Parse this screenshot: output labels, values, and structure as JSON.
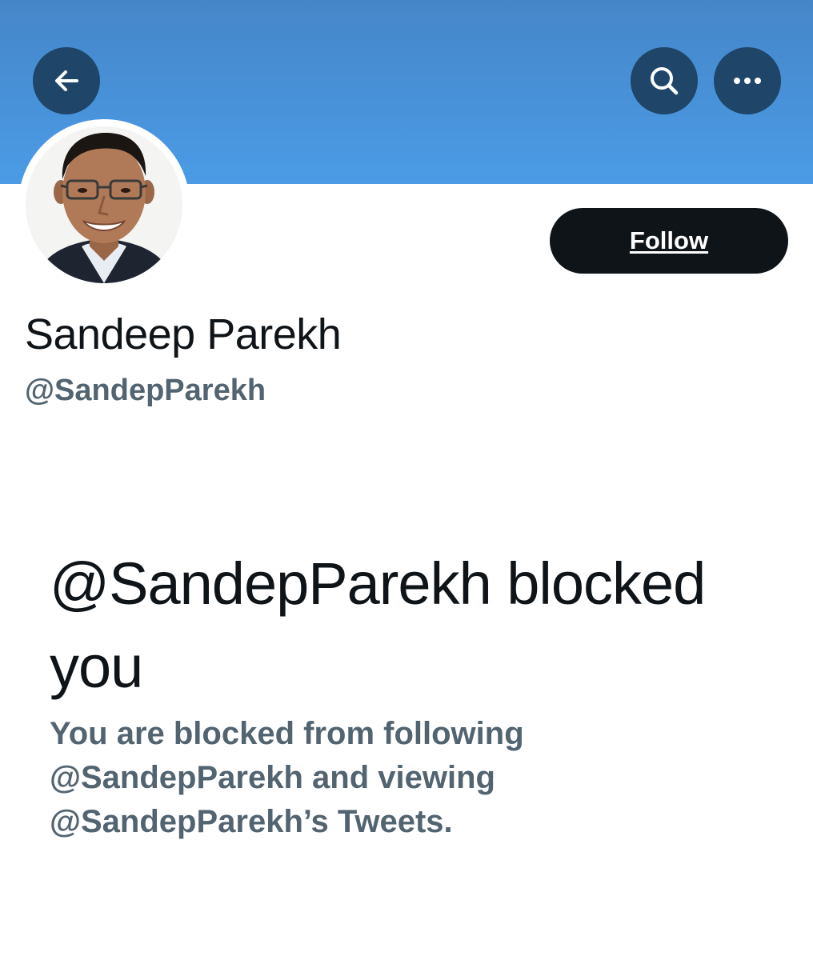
{
  "profile": {
    "display_name": "Sandeep Parekh",
    "handle": "@SandepParekh"
  },
  "header": {
    "back_icon": "arrow-left-icon",
    "search_icon": "search-icon",
    "more_icon": "more-horizontal-icon"
  },
  "actions": {
    "follow_label": "Follow"
  },
  "blocked": {
    "title": "@SandepParekh blocked you",
    "description": "You are blocked from following @SandepParekh and viewing @SandepParekh’s Tweets."
  },
  "colors": {
    "banner": "#4b9be6",
    "header_button": "#1f4569",
    "follow_button": "#0f1419",
    "primary_text": "#0f1419",
    "secondary_text": "#536471"
  }
}
